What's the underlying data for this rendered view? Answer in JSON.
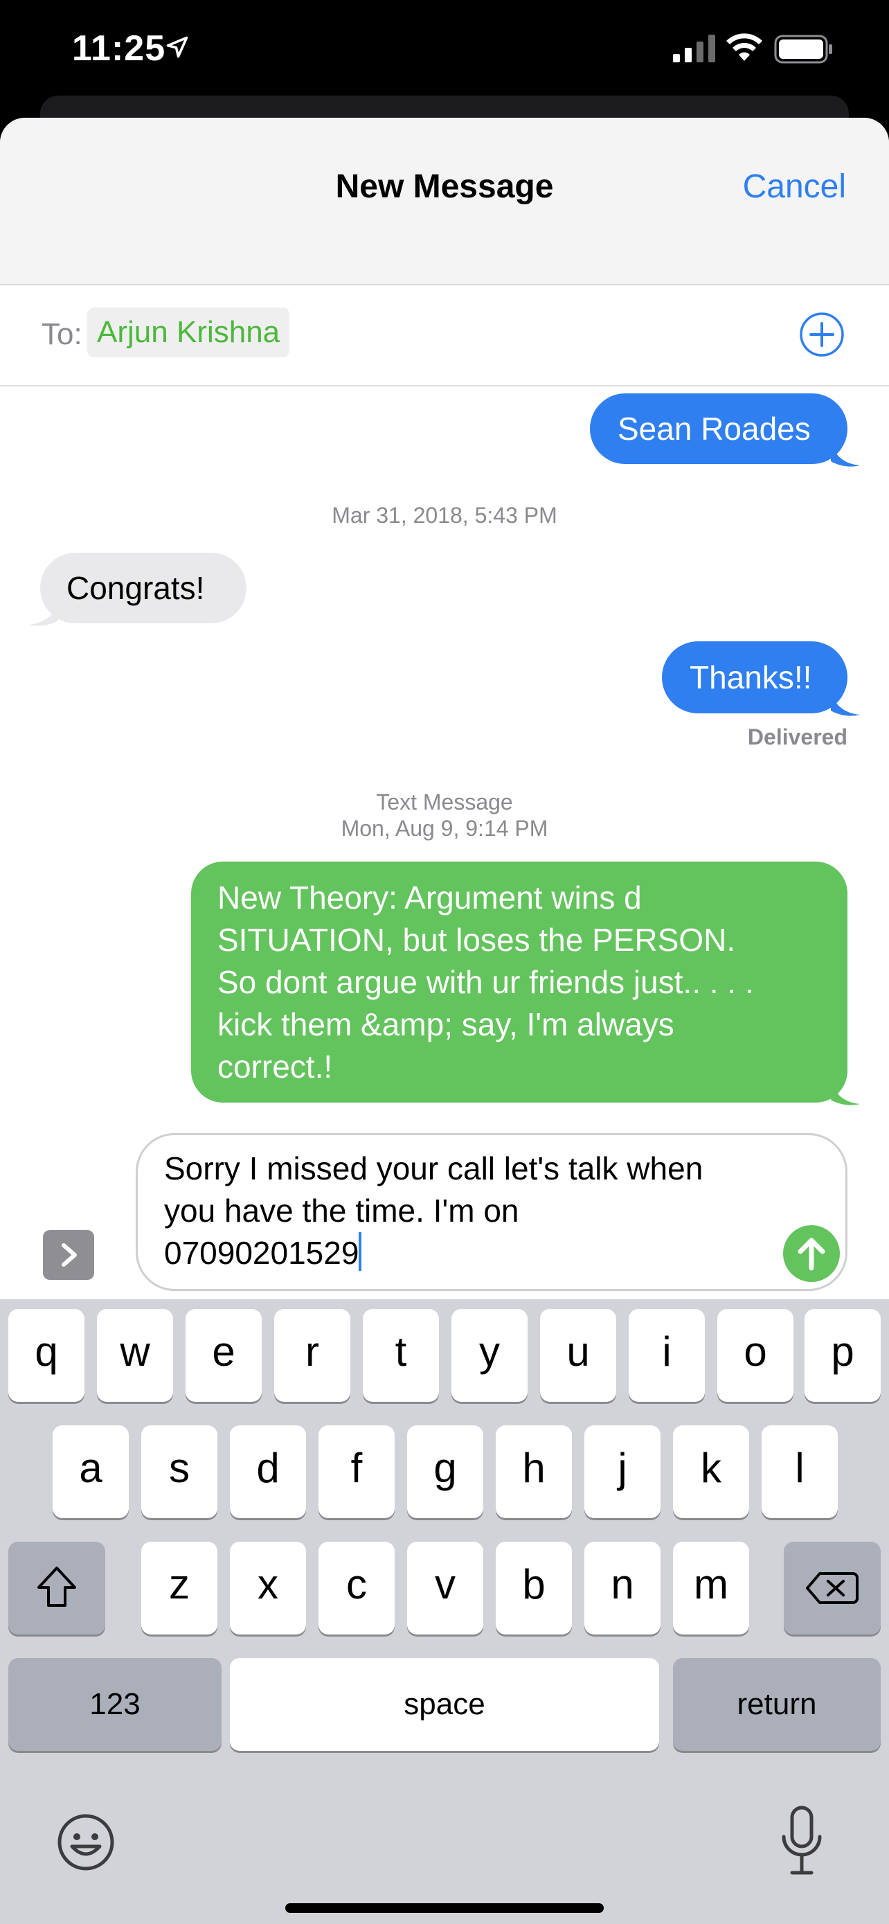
{
  "status_bar": {
    "time": "11:25"
  },
  "header": {
    "title": "New Message",
    "cancel_label": "Cancel"
  },
  "recipient": {
    "to_label": "To:",
    "name": "Arjun Krishna"
  },
  "colors": {
    "imessage_blue": "#2f7ff0",
    "sms_green": "#63c35d",
    "received_gray": "#e9e9eb",
    "recipient_green": "#4cb83c"
  },
  "messages": [
    {
      "direction": "sent",
      "kind": "imessage",
      "text": "Sean Roades"
    },
    {
      "direction": "received",
      "kind": "imessage",
      "text": "Congrats!"
    },
    {
      "direction": "sent",
      "kind": "imessage",
      "text": "Thanks!!"
    },
    {
      "direction": "sent",
      "kind": "sms",
      "lines": [
        "New Theory: Argument wins d",
        "SITUATION, but loses the PERSON.",
        "So dont argue with ur friends just.. . . .",
        "kick them &amp; say, I'm always",
        "correct.!"
      ]
    }
  ],
  "timestamps": {
    "first": "Mar 31, 2018, 5:43 PM",
    "second_type": "Text Message",
    "second": "Mon, Aug 9, 9:14 PM"
  },
  "delivered_label": "Delivered",
  "composer": {
    "lines": [
      "Sorry I missed your call let's talk when",
      "you have the time. I'm on",
      "07090201529"
    ]
  },
  "keyboard": {
    "row1": [
      "q",
      "w",
      "e",
      "r",
      "t",
      "y",
      "u",
      "i",
      "o",
      "p"
    ],
    "row2": [
      "a",
      "s",
      "d",
      "f",
      "g",
      "h",
      "j",
      "k",
      "l"
    ],
    "row3": [
      "z",
      "x",
      "c",
      "v",
      "b",
      "n",
      "m"
    ],
    "numbers_label": "123",
    "space_label": "space",
    "return_label": "return"
  },
  "icons": [
    "location-arrow-icon",
    "signal-icon",
    "wifi-icon",
    "battery-icon",
    "add-contact-icon",
    "expand-icon",
    "send-arrow-icon",
    "shift-icon",
    "backspace-icon",
    "emoji-icon",
    "microphone-icon"
  ]
}
